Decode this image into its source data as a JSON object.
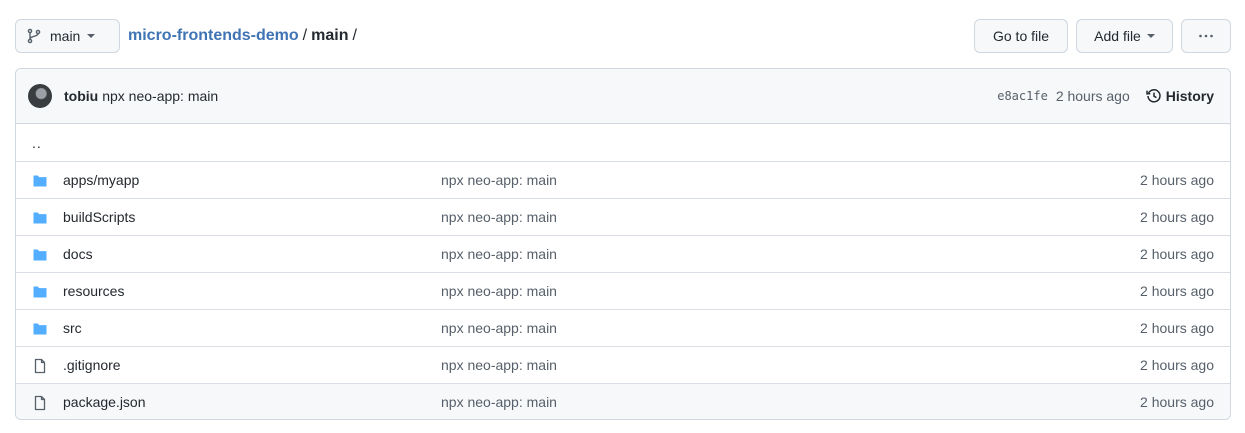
{
  "topbar": {
    "branch": "main",
    "breadcrumb": {
      "repo": "micro-frontends-demo",
      "sep1": "/",
      "path": "main",
      "sep2": "/"
    },
    "goto_file": "Go to file",
    "add_file": "Add file",
    "more": "···"
  },
  "commit": {
    "author": "tobiu",
    "message": "npx neo-app: main",
    "sha": "e8ac1fe",
    "time": "2 hours ago",
    "history": "History"
  },
  "files": {
    "parent": "..",
    "rows": [
      {
        "type": "dir",
        "name_prefix": "apps/",
        "name": "myapp",
        "message": "npx neo-app: main",
        "time": "2 hours ago"
      },
      {
        "type": "dir",
        "name_prefix": "",
        "name": "buildScripts",
        "message": "npx neo-app: main",
        "time": "2 hours ago"
      },
      {
        "type": "dir",
        "name_prefix": "",
        "name": "docs",
        "message": "npx neo-app: main",
        "time": "2 hours ago"
      },
      {
        "type": "dir",
        "name_prefix": "",
        "name": "resources",
        "message": "npx neo-app: main",
        "time": "2 hours ago"
      },
      {
        "type": "dir",
        "name_prefix": "",
        "name": "src",
        "message": "npx neo-app: main",
        "time": "2 hours ago"
      },
      {
        "type": "file",
        "name_prefix": "",
        "name": ".gitignore",
        "message": "npx neo-app: main",
        "time": "2 hours ago"
      },
      {
        "type": "file",
        "name_prefix": "",
        "name": "package.json",
        "message": "npx neo-app: main",
        "time": "2 hours ago"
      }
    ]
  },
  "colors": {
    "link": "#3f74b5",
    "folder": "#54aeff",
    "border": "#d0d7de",
    "muted": "#57606a"
  }
}
